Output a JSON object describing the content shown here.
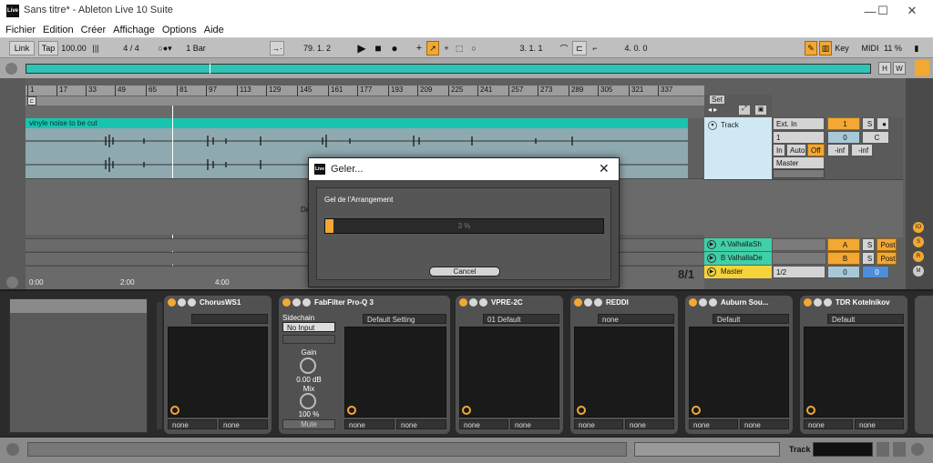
{
  "window": {
    "title": "Sans titre* - Ableton Live 10 Suite",
    "logo": "Live",
    "minimize": "—",
    "maximize": "☐",
    "close": "✕"
  },
  "menu": [
    "Fichier",
    "Edition",
    "Créer",
    "Affichage",
    "Options",
    "Aide"
  ],
  "control": {
    "link": "Link",
    "tap": "Tap",
    "tempo": "100.00",
    "signature": "4 / 4",
    "quant": "1 Bar",
    "position": "79.  1.  2",
    "loop_start": "3.  1.  1",
    "loop_length": "4.  0.  0",
    "key": "Key",
    "midi": "MIDI",
    "cpu": "11 %",
    "overview_h": "H",
    "overview_w": "W"
  },
  "ruler": {
    "ticks": [
      "1",
      "17",
      "33",
      "49",
      "65",
      "81",
      "97",
      "113",
      "129",
      "145",
      "161",
      "177",
      "193",
      "209",
      "225",
      "241",
      "257",
      "273",
      "289",
      "305",
      "321",
      "337"
    ],
    "times": [
      "0:00",
      "2:00",
      "4:00"
    ],
    "time_display": "8/1"
  },
  "clip": {
    "name": "vinyle noise to be cut"
  },
  "mixer": {
    "set_label": "Set",
    "track": {
      "name": "Track",
      "input": "Ext. In",
      "channel": "1",
      "in": "In",
      "auto": "Auto",
      "off": "Off",
      "out": "Master",
      "number": "1",
      "s": "S",
      "vol": "0",
      "pan": "C",
      "inf1": "-inf",
      "inf2": "-inf"
    },
    "returns": [
      {
        "name": "A ValhallaSh",
        "letter": "A",
        "s": "S",
        "post": "Post"
      },
      {
        "name": "B ValhallaDe",
        "letter": "B",
        "s": "S",
        "post": "Post"
      }
    ],
    "master": {
      "name": "Master",
      "cue": "1/2",
      "vol": "0",
      "pan": "0"
    }
  },
  "dialog": {
    "title": "Geler...",
    "logo": "Live",
    "heading": "Gel de l'Arrangement",
    "progress_text": "3 %",
    "progress": 0.03,
    "cancel": "Cancel",
    "behind_text": "De"
  },
  "devices": [
    {
      "name": "ChorusWS1",
      "preset": "",
      "none1": "none",
      "none2": "none"
    },
    {
      "name": "FabFilter Pro-Q 3",
      "preset": "Default Setting",
      "sidechain": "Sidechain",
      "input": "No Input",
      "gain_label": "Gain",
      "gain": "0.00 dB",
      "mix_label": "Mix",
      "mix": "100 %",
      "mute": "Mute",
      "none1": "none",
      "none2": "none"
    },
    {
      "name": "VPRE-2C",
      "preset": "01 Default",
      "none1": "none",
      "none2": "none"
    },
    {
      "name": "REDDI",
      "preset": "none",
      "none1": "none",
      "none2": "none"
    },
    {
      "name": "Auburn Sou...",
      "preset": "Default",
      "none1": "none",
      "none2": "none"
    },
    {
      "name": "TDR Kotelnikov",
      "preset": "Default",
      "none1": "none",
      "none2": "none"
    }
  ],
  "status": {
    "track": "Track"
  },
  "colors": {
    "accent": "#f2a833",
    "clip": "#19c4ae",
    "return": "#3fd0a8",
    "master": "#f5d33a"
  }
}
